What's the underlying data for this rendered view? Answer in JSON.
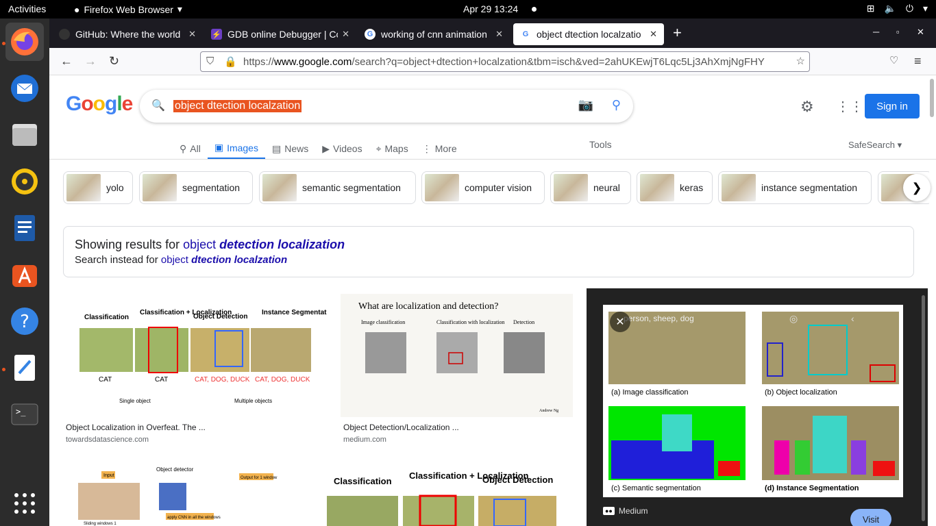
{
  "topbar": {
    "activities": "Activities",
    "app": "Firefox Web Browser",
    "clock": "Apr 29  13:24"
  },
  "tabs": [
    {
      "title": "GitHub: Where the world",
      "favicon": "github-icon"
    },
    {
      "title": "GDB online Debugger | Co",
      "favicon": "gdb-icon"
    },
    {
      "title": "working of cnn animation",
      "favicon": "google-icon"
    },
    {
      "title": "object dtection localzatio",
      "favicon": "google-icon"
    }
  ],
  "url": {
    "prefix": "https://",
    "domain": "www.google.com",
    "path": "/search?q=object+dtection+localzation&tbm=isch&ved=2ahUKEwjT6Lqc5Lj3AhXmjNgFHY"
  },
  "search": {
    "query": "object dtection localzation"
  },
  "header": {
    "signin": "Sign in",
    "tools": "Tools",
    "safesearch": "SafeSearch"
  },
  "stabs": [
    "All",
    "Images",
    "News",
    "Videos",
    "Maps",
    "More"
  ],
  "chips": [
    "yolo",
    "segmentation",
    "semantic segmentation",
    "computer vision",
    "neural",
    "keras",
    "instance segmentation"
  ],
  "correction": {
    "showing": "Showing results for ",
    "c1": "object ",
    "c2": "detection localization",
    "instead": "Search instead for ",
    "o1": "object ",
    "o2": "dtection localzation"
  },
  "results": [
    {
      "caption": "Object Localization in Overfeat. The ...",
      "source": "towardsdatascience.com",
      "labels": [
        "Classification",
        "Classification + Localization",
        "Object Detection",
        "Instance Segmentation",
        "CAT",
        "CAT",
        "CAT, DOG, DUCK",
        "CAT, DOG, DUCK",
        "Single object",
        "Multiple objects"
      ]
    },
    {
      "caption": "Object Detection/Localization ...",
      "source": "medium.com",
      "labels": [
        "What are localization and detection?",
        "Image classification",
        "Classification with localization",
        "Detection",
        "Andrew Ng"
      ]
    },
    {
      "labels": [
        "Input",
        "Object detector",
        "Output for 1 window",
        "Sliding windows 1",
        "apply CNN in all the windows"
      ]
    },
    {
      "labels": [
        "Classification",
        "Classification + Localization",
        "Object Detection"
      ]
    }
  ],
  "preview": {
    "source": "Medium",
    "visit": "Visit",
    "header": "person, sheep, dog",
    "subcaptions": [
      "(a) Image classification",
      "(b) Object localization",
      "(c) Semantic segmentation",
      "(d) Instance Segmentation"
    ]
  }
}
